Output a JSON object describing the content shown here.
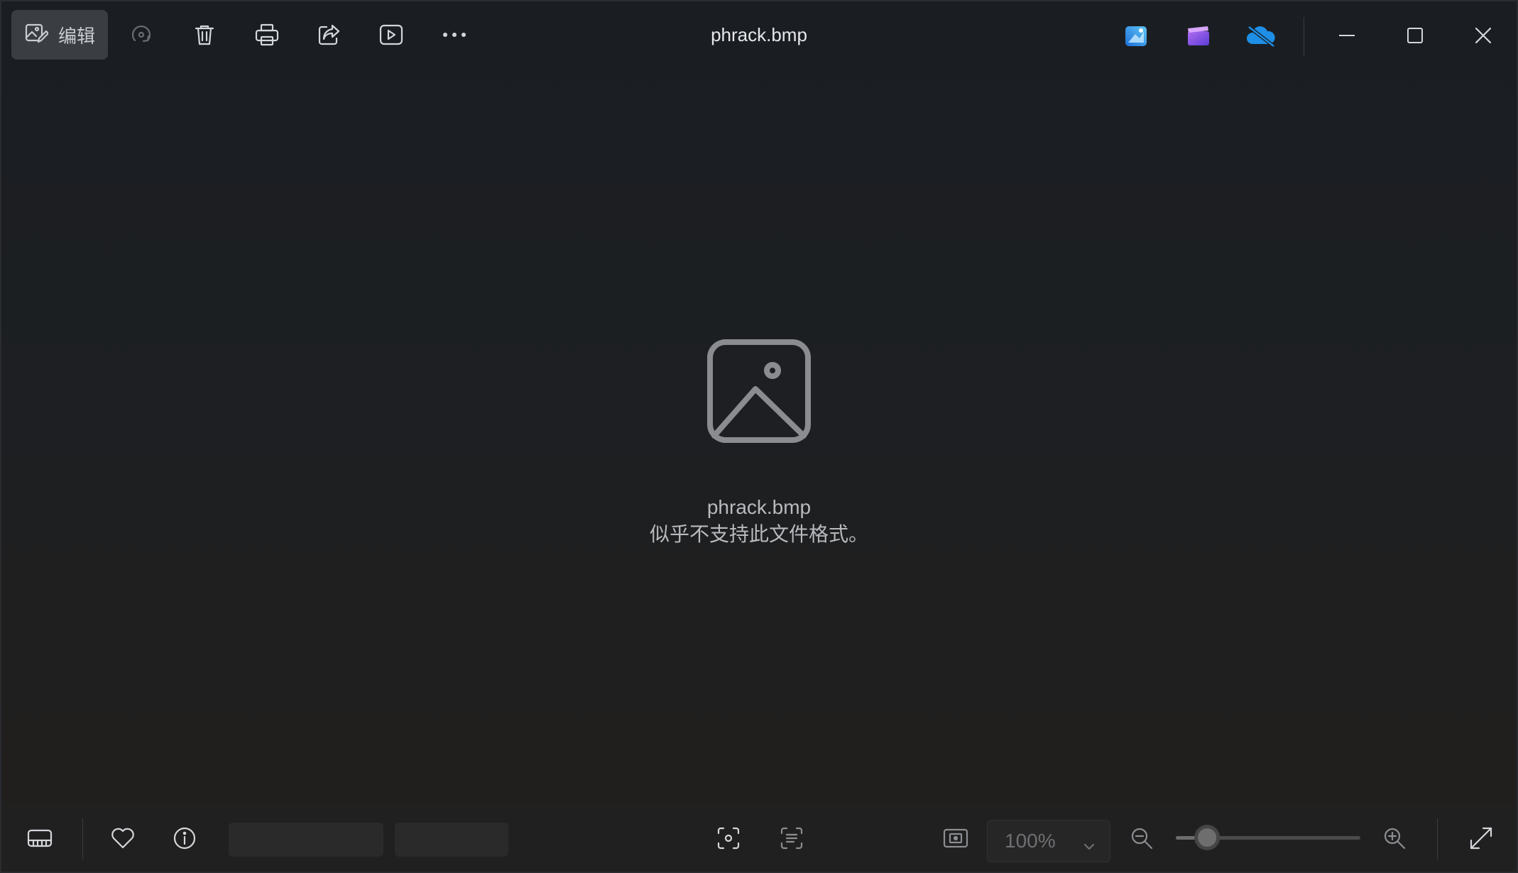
{
  "toolbar": {
    "edit_label": "编辑"
  },
  "window": {
    "title": "phrack.bmp"
  },
  "placeholder": {
    "filename": "phrack.bmp",
    "message": "似乎不支持此文件格式。"
  },
  "zoom": {
    "level_text": "100%",
    "slider_fraction": 0.17
  },
  "colors": {
    "icon": "#d4d6da",
    "icon_dim": "#6a6c70",
    "placeholder": "#8a8c90"
  }
}
